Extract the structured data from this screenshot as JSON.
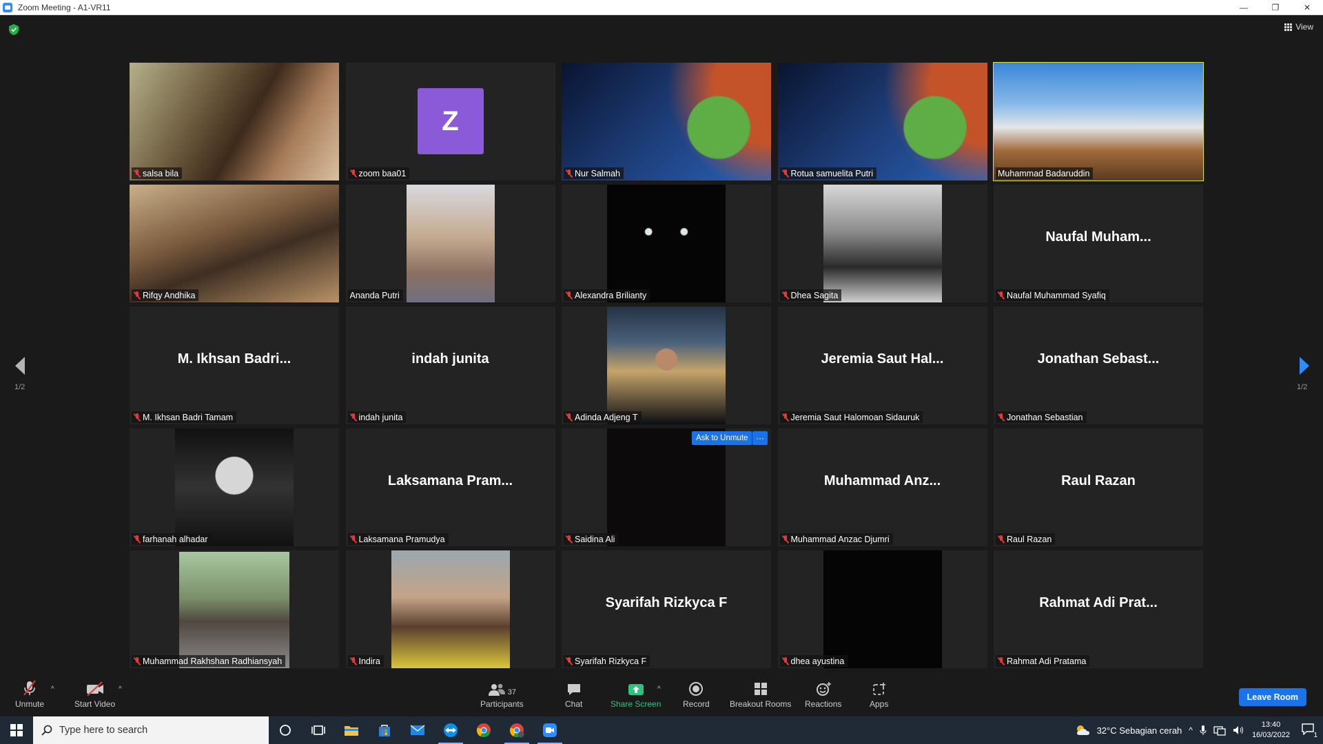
{
  "window": {
    "title": "Zoom Meeting - A1-VR11",
    "minimize": "—",
    "restore": "❐",
    "close": "✕"
  },
  "view_label": "View",
  "pagination": {
    "left": "1/2",
    "right": "1/2"
  },
  "participants": [
    {
      "name": "salsa bila",
      "big": "",
      "muted": true,
      "video": "photo-room",
      "active": false
    },
    {
      "name": "zoom baa01",
      "big": "",
      "muted": true,
      "video": "avatar",
      "avatar_letter": "Z",
      "active": false
    },
    {
      "name": "Nur Salmah",
      "big": "",
      "muted": true,
      "video": "frog-bg",
      "active": false
    },
    {
      "name": "Rotua samuelita Putri",
      "big": "",
      "muted": true,
      "video": "frog-bg",
      "active": false
    },
    {
      "name": "Muhammad Badaruddin",
      "big": "",
      "muted": false,
      "video": "outdoor",
      "active": true
    },
    {
      "name": "Rifqy Andhika",
      "big": "",
      "muted": true,
      "video": "office",
      "active": false
    },
    {
      "name": "Ananda Putri",
      "big": "",
      "muted": false,
      "video": "portrait-light",
      "active": false
    },
    {
      "name": "Alexandra Brilianty",
      "big": "",
      "muted": true,
      "video": "black-cat",
      "active": false
    },
    {
      "name": "Dhea Sagita",
      "big": "",
      "muted": true,
      "video": "bw-photo",
      "active": false
    },
    {
      "name": "Naufal Muhammad Syafiq",
      "big": "Naufal  Muham...",
      "muted": true,
      "video": "none",
      "active": false
    },
    {
      "name": "M. Ikhsan Badri Tamam",
      "big": "M. Ikhsan Badri...",
      "muted": true,
      "video": "none",
      "active": false
    },
    {
      "name": "indah junita",
      "big": "indah junita",
      "muted": true,
      "video": "none",
      "active": false
    },
    {
      "name": "Adinda Adjeng T",
      "big": "",
      "muted": true,
      "video": "night-city",
      "active": false
    },
    {
      "name": "Jeremia Saut Halomoan Sidauruk",
      "big": "Jeremia Saut Hal...",
      "muted": true,
      "video": "none",
      "active": false
    },
    {
      "name": "Jonathan Sebastian",
      "big": "Jonathan  Sebast...",
      "muted": true,
      "video": "none",
      "active": false
    },
    {
      "name": "farhanah alhadar",
      "big": "",
      "muted": true,
      "video": "bw-sticker",
      "active": false
    },
    {
      "name": "Laksamana Pramudya",
      "big": "Laksamana  Pram...",
      "muted": true,
      "video": "none",
      "active": false
    },
    {
      "name": "Saidina Ali",
      "big": "",
      "muted": true,
      "video": "dark",
      "active": false,
      "ask_unmute": "Ask to Unmute",
      "more": "···"
    },
    {
      "name": "Muhammad Anzac Djumri",
      "big": "Muhammad  Anz...",
      "muted": true,
      "video": "none",
      "active": false
    },
    {
      "name": "Raul Razan",
      "big": "Raul Razan",
      "muted": true,
      "video": "none",
      "active": false
    },
    {
      "name": "Muhammad Rakhshan Radhiansyah",
      "big": "",
      "muted": true,
      "video": "street",
      "active": false
    },
    {
      "name": "Indira",
      "big": "",
      "muted": true,
      "video": "selfie",
      "active": false
    },
    {
      "name": "Syarifah Rizkyca F",
      "big": "Syarifah Rizkyca F",
      "muted": true,
      "video": "none",
      "active": false
    },
    {
      "name": "dhea ayustina",
      "big": "",
      "muted": true,
      "video": "black",
      "active": false
    },
    {
      "name": "Rahmat Adi Pratama",
      "big": "Rahmat Adi Prat...",
      "muted": true,
      "video": "none",
      "active": false
    }
  ],
  "toolbar": {
    "unmute": "Unmute",
    "start_video": "Start Video",
    "participants": "Participants",
    "participants_count": "37",
    "chat": "Chat",
    "share_screen": "Share Screen",
    "record": "Record",
    "breakout_rooms": "Breakout Rooms",
    "reactions": "Reactions",
    "apps": "Apps",
    "leave": "Leave Room"
  },
  "taskbar": {
    "search_placeholder": "Type here to search",
    "weather": "32°C  Sebagian cerah",
    "time": "13:40",
    "date": "16/03/2022",
    "notif_count": "1"
  },
  "colors": {
    "accent": "#1a73e8",
    "active_speaker": "#d7e34a",
    "muted": "#e03a3a",
    "share": "#2ec27e"
  }
}
